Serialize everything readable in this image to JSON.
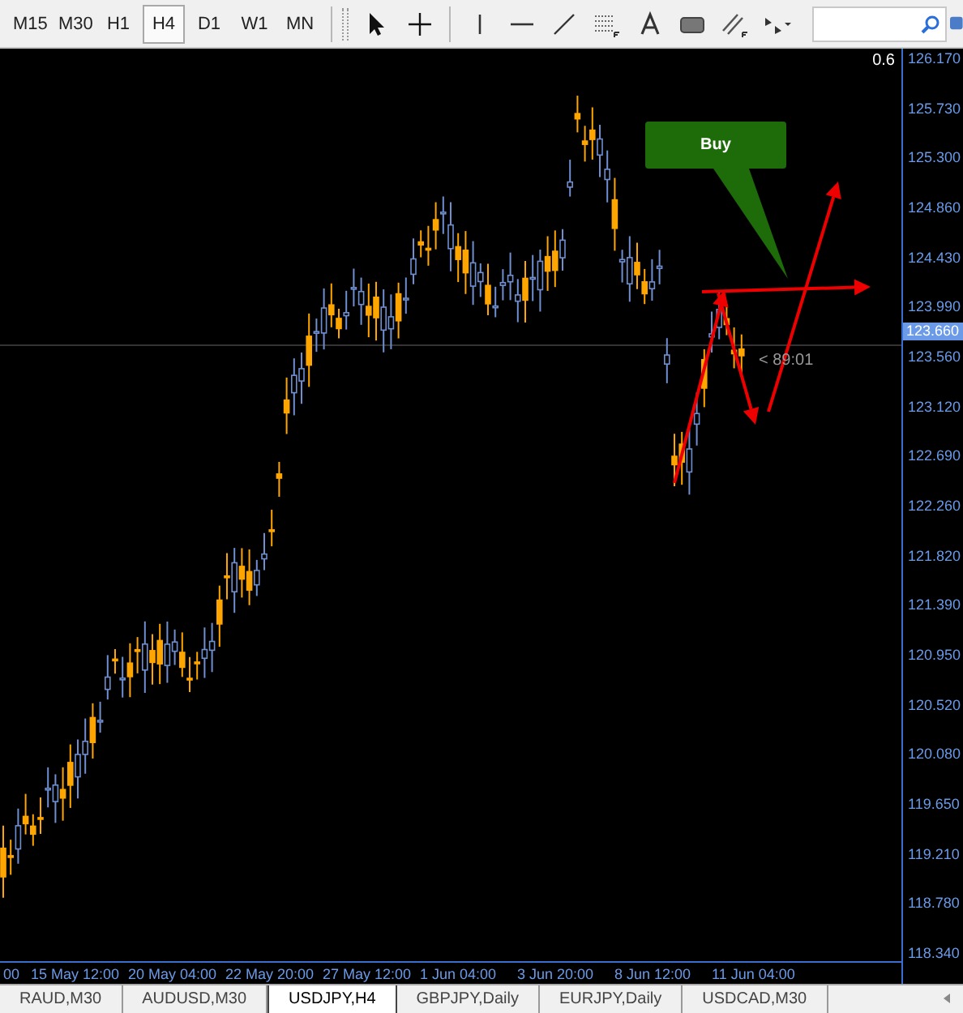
{
  "toolbar": {
    "timeframes": [
      {
        "label": "M15",
        "selected": false
      },
      {
        "label": "M30",
        "selected": false
      },
      {
        "label": "H1",
        "selected": false
      },
      {
        "label": "H4",
        "selected": true
      },
      {
        "label": "D1",
        "selected": false
      },
      {
        "label": "W1",
        "selected": false
      },
      {
        "label": "MN",
        "selected": false
      }
    ]
  },
  "chart": {
    "corner_value": "0.6",
    "callout": "Buy",
    "countdown": "< 89:01",
    "current_price": "123.660",
    "price_ticks": [
      "126.170",
      "125.730",
      "125.300",
      "124.860",
      "124.430",
      "123.990",
      "123.560",
      "123.120",
      "122.690",
      "122.260",
      "121.820",
      "121.390",
      "120.950",
      "120.520",
      "120.080",
      "119.650",
      "119.210",
      "118.780",
      "118.340"
    ],
    "time_ticks": [
      "00",
      "15 May 12:00",
      "20 May 04:00",
      "22 May 20:00",
      "27 May 12:00",
      "1 Jun 04:00",
      "3 Jun 20:00",
      "8 Jun 12:00",
      "11 Jun 04:00"
    ]
  },
  "tabs": [
    {
      "label": "RAUD,M30",
      "selected": false
    },
    {
      "label": "AUDUSD,M30",
      "selected": false
    },
    {
      "label": "USDJPY,H4",
      "selected": true
    },
    {
      "label": "GBPJPY,Daily",
      "selected": false
    },
    {
      "label": "EURJPY,Daily",
      "selected": false
    },
    {
      "label": "USDCAD,M30",
      "selected": false
    }
  ]
}
